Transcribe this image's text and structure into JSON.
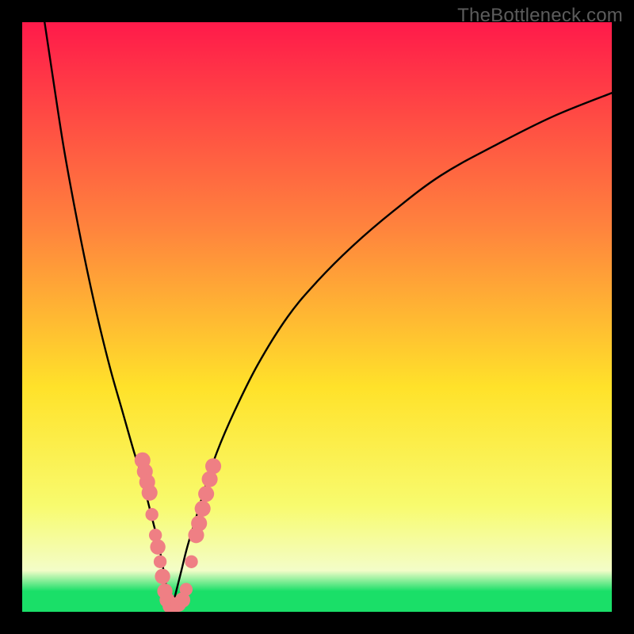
{
  "watermark": "TheBottleneck.com",
  "colors": {
    "frame": "#000000",
    "curve": "#000000",
    "marker_fill": "#ef7f84",
    "grad_top": "#ff1a4a",
    "grad_mid1": "#ff843d",
    "grad_mid2": "#ffe22a",
    "grad_mid3": "#f8fb6e",
    "grad_low": "#f3fdc8",
    "grad_green": "#1adf68"
  },
  "chart_data": {
    "type": "line",
    "title": "",
    "xlabel": "",
    "ylabel": "",
    "xlim": [
      0,
      100
    ],
    "ylim": [
      0,
      100
    ],
    "series": [
      {
        "name": "left-branch",
        "x": [
          3.8,
          5,
          7,
          9,
          11,
          13,
          15,
          17,
          19,
          20,
          21,
          22,
          23,
          23.8,
          24.5,
          25.2
        ],
        "y": [
          100,
          92,
          79,
          68,
          58,
          49,
          41,
          34,
          27,
          24,
          20,
          16,
          12,
          8,
          4,
          0
        ]
      },
      {
        "name": "right-branch",
        "x": [
          25.2,
          26,
          27,
          28,
          29.5,
          31,
          33,
          36,
          40,
          45,
          50,
          56,
          63,
          71,
          80,
          90,
          100
        ],
        "y": [
          0,
          3,
          7,
          11,
          16,
          21,
          27,
          34,
          42,
          50,
          56,
          62,
          68,
          74,
          79,
          84,
          88
        ]
      }
    ],
    "markers": [
      {
        "x": 20.4,
        "y": 25.7,
        "r": 1.35
      },
      {
        "x": 20.8,
        "y": 23.8,
        "r": 1.35
      },
      {
        "x": 21.2,
        "y": 22.0,
        "r": 1.35
      },
      {
        "x": 21.6,
        "y": 20.2,
        "r": 1.35
      },
      {
        "x": 22.0,
        "y": 16.5,
        "r": 1.1
      },
      {
        "x": 22.6,
        "y": 13.0,
        "r": 1.1
      },
      {
        "x": 23.0,
        "y": 11.0,
        "r": 1.3
      },
      {
        "x": 23.4,
        "y": 8.5,
        "r": 1.1
      },
      {
        "x": 23.8,
        "y": 6.0,
        "r": 1.3
      },
      {
        "x": 24.2,
        "y": 3.5,
        "r": 1.3
      },
      {
        "x": 24.6,
        "y": 2.0,
        "r": 1.3
      },
      {
        "x": 25.1,
        "y": 1.0,
        "r": 1.3
      },
      {
        "x": 25.8,
        "y": 1.0,
        "r": 1.3
      },
      {
        "x": 26.5,
        "y": 1.3,
        "r": 1.3
      },
      {
        "x": 27.2,
        "y": 2.0,
        "r": 1.3
      },
      {
        "x": 27.8,
        "y": 3.8,
        "r": 1.1
      },
      {
        "x": 28.7,
        "y": 8.5,
        "r": 1.1
      },
      {
        "x": 29.5,
        "y": 13.0,
        "r": 1.35
      },
      {
        "x": 30.0,
        "y": 15.0,
        "r": 1.35
      },
      {
        "x": 30.6,
        "y": 17.5,
        "r": 1.35
      },
      {
        "x": 31.2,
        "y": 20.0,
        "r": 1.35
      },
      {
        "x": 31.8,
        "y": 22.5,
        "r": 1.35
      },
      {
        "x": 32.4,
        "y": 24.7,
        "r": 1.35
      }
    ],
    "gradient_stops": [
      {
        "offset": 0,
        "color_key": "grad_top"
      },
      {
        "offset": 0.35,
        "color_key": "grad_mid1"
      },
      {
        "offset": 0.62,
        "color_key": "grad_mid2"
      },
      {
        "offset": 0.82,
        "color_key": "grad_mid3"
      },
      {
        "offset": 0.93,
        "color_key": "grad_low"
      },
      {
        "offset": 0.965,
        "color_key": "grad_green"
      },
      {
        "offset": 1.0,
        "color_key": "grad_green"
      }
    ]
  }
}
